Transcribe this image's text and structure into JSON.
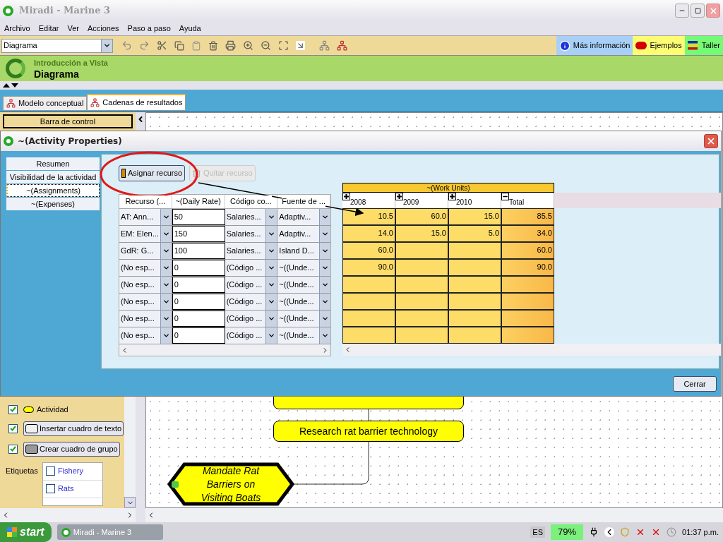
{
  "window": {
    "title": "Miradi - Marine 3"
  },
  "menu": [
    "Archivo",
    "Editar",
    "Ver",
    "Acciones",
    "Paso a paso",
    "Ayuda"
  ],
  "toolbar": {
    "view_select": "Diagrama",
    "help_buttons": [
      {
        "label": "Más información",
        "kind": "info"
      },
      {
        "label": "Ejemplos",
        "kind": "examples"
      },
      {
        "label": "Taller",
        "kind": "workshop"
      }
    ]
  },
  "banner": {
    "subtitle": "Introducción a Vista",
    "title": "Diagrama"
  },
  "tabs": [
    {
      "label": "Modelo conceptual",
      "selected": false
    },
    {
      "label": "Cadenas de resultados",
      "selected": true
    }
  ],
  "control_bar": {
    "label": "Barra de control"
  },
  "legend": {
    "items": [
      {
        "label": "Actividad",
        "checked": true,
        "kind": "swatch"
      },
      {
        "label": "Insertar cuadro de texto",
        "checked": true,
        "kind": "button"
      },
      {
        "label": "Crear cuadro de grupo",
        "checked": true,
        "kind": "button"
      }
    ],
    "tags_label": "Etiquetas",
    "tags": [
      {
        "label": "Fishery",
        "checked": false
      },
      {
        "label": "Rats",
        "checked": false
      }
    ]
  },
  "diagram": {
    "nodes": [
      {
        "kind": "result",
        "label": "Research rat barrier technology"
      },
      {
        "kind": "strategy",
        "label": "Mandate Rat Barriers on Visiting Boats"
      }
    ]
  },
  "dialog": {
    "title": "~(Activity Properties)",
    "nav": [
      {
        "label": "Resumen",
        "selected": false
      },
      {
        "label": "Visibilidad de la actividad",
        "selected": false
      },
      {
        "label": "~(Assignments)",
        "selected": true
      },
      {
        "label": "~(Expenses)",
        "selected": false
      }
    ],
    "actions": [
      {
        "label": "Asignar recurso",
        "disabled": false
      },
      {
        "label": "Quitar recurso",
        "disabled": true
      }
    ],
    "assignments": {
      "columns": [
        "Recurso (...",
        "~(Daily Rate)",
        "Código co...",
        "Fuente de ..."
      ],
      "rows": [
        {
          "resource": "AT: Ann...",
          "rate": "50",
          "code": "Salaries...",
          "source": "Adaptiv..."
        },
        {
          "resource": "EM: Elen...",
          "rate": "150",
          "code": "Salaries...",
          "source": "Adaptiv..."
        },
        {
          "resource": "GdR: G...",
          "rate": "100",
          "code": "Salaries...",
          "source": "Island D..."
        },
        {
          "resource": "(No esp...",
          "rate": "0",
          "code": "(Código ...",
          "source": "~((Unde..."
        },
        {
          "resource": "(No esp...",
          "rate": "0",
          "code": "(Código ...",
          "source": "~((Unde..."
        },
        {
          "resource": "(No esp...",
          "rate": "0",
          "code": "(Código ...",
          "source": "~((Unde..."
        },
        {
          "resource": "(No esp...",
          "rate": "0",
          "code": "(Código ...",
          "source": "~((Unde..."
        },
        {
          "resource": "(No esp...",
          "rate": "0",
          "code": "(Código ...",
          "source": "~((Unde..."
        }
      ]
    },
    "work_units": {
      "title": "~(Work Units)",
      "columns": [
        {
          "label": "2008",
          "expanded": false,
          "kind": "year"
        },
        {
          "label": "2009",
          "expanded": false,
          "kind": "year"
        },
        {
          "label": "2010",
          "expanded": false,
          "kind": "year"
        },
        {
          "label": "Total",
          "expanded": true,
          "kind": "total"
        }
      ],
      "rows": [
        [
          "10.5",
          "60.0",
          "15.0",
          "85.5"
        ],
        [
          "14.0",
          "15.0",
          "5.0",
          "34.0"
        ],
        [
          "60.0",
          null,
          null,
          "60.0"
        ],
        [
          "90.0",
          null,
          null,
          "90.0"
        ],
        [
          null,
          null,
          null,
          null
        ],
        [
          null,
          null,
          null,
          null
        ],
        [
          null,
          null,
          null,
          null
        ],
        [
          null,
          null,
          null,
          null
        ]
      ]
    },
    "close_button": "Cerrar"
  },
  "taskbar": {
    "start": "start",
    "task": "Miradi - Marine 3",
    "language": "ES",
    "battery": "79%",
    "time": "01:37 p.m."
  }
}
